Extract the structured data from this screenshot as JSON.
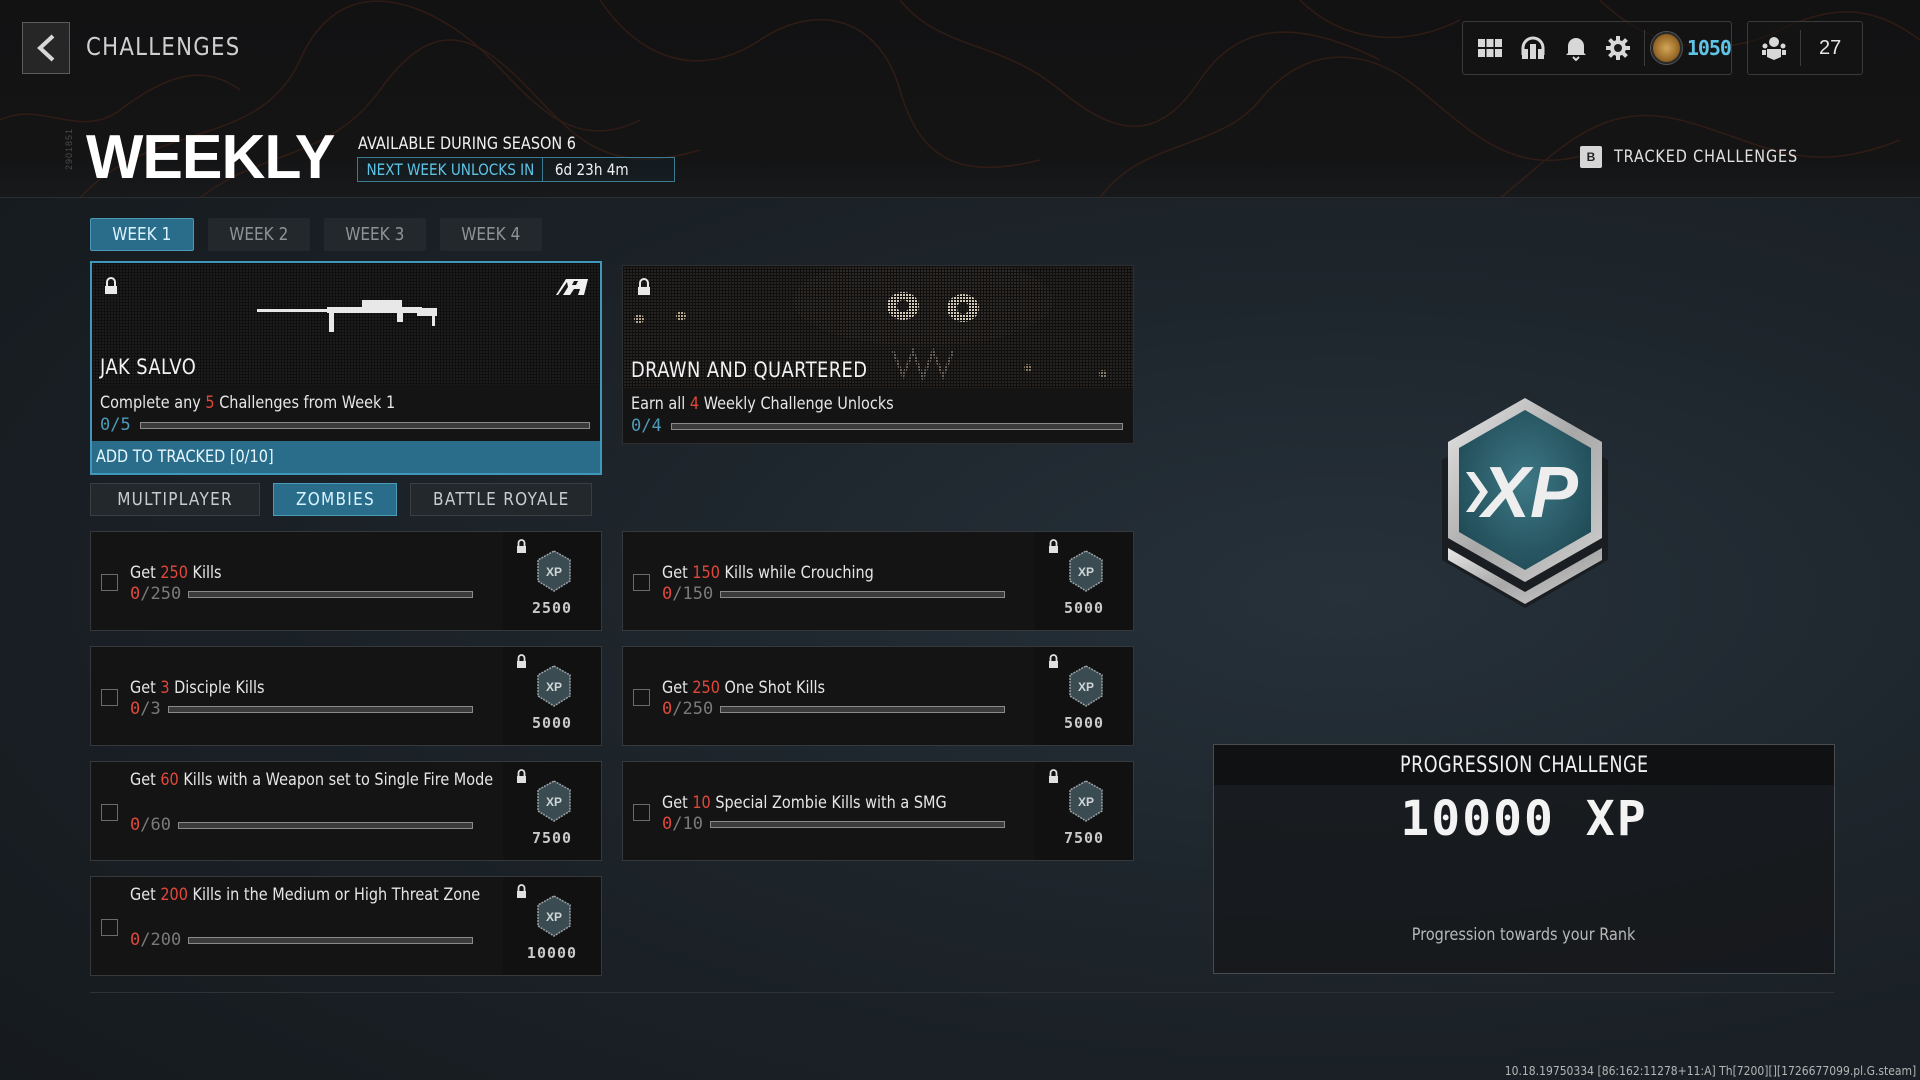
{
  "header": {
    "screen_title": "CHALLENGES",
    "season_code": "2901851",
    "page_title": "WEEKLY",
    "availability": "AVAILABLE DURING SEASON 6",
    "next_unlock_label": "NEXT WEEK UNLOCKS IN",
    "next_unlock_time": "6d 23h 4m",
    "tracked_key": "B",
    "tracked_label": "TRACKED CHALLENGES"
  },
  "top_bar": {
    "icons": [
      "grid-menu-icon",
      "headset-icon",
      "bell-icon",
      "gear-icon"
    ],
    "currency_value": "1050",
    "party_count": "27",
    "accent_color": "#5fc3e6"
  },
  "week_tabs": [
    {
      "label": "WEEK 1",
      "active": true
    },
    {
      "label": "WEEK 2",
      "active": false
    },
    {
      "label": "WEEK 3",
      "active": false
    },
    {
      "label": "WEEK 4",
      "active": false
    }
  ],
  "rewards": [
    {
      "name": "JAK SALVO",
      "desc_pre": "Complete any ",
      "desc_num": "5",
      "desc_post": " Challenges from Week 1",
      "progress": "0/5",
      "progress_value": 0,
      "progress_max": 5,
      "locked": true,
      "selected": true,
      "track_label": "ADD TO TRACKED [0/10]"
    },
    {
      "name": "DRAWN AND QUARTERED",
      "desc_pre": "Earn all ",
      "desc_num": "4",
      "desc_post": " Weekly Challenge Unlocks",
      "progress": "0/4",
      "progress_value": 0,
      "progress_max": 4,
      "locked": true,
      "selected": false
    }
  ],
  "mode_tabs": [
    {
      "label": "MULTIPLAYER",
      "active": false
    },
    {
      "label": "ZOMBIES",
      "active": true
    },
    {
      "label": "BATTLE ROYALE",
      "active": false
    }
  ],
  "challenges": [
    {
      "pre": "Get ",
      "num": "250",
      "post": " Kills",
      "current": "0",
      "total": "/250",
      "xp": "2500",
      "locked": true
    },
    {
      "pre": "Get ",
      "num": "150",
      "post": " Kills while Crouching",
      "current": "0",
      "total": "/150",
      "xp": "5000",
      "locked": true
    },
    {
      "pre": "Get ",
      "num": "3",
      "post": " Disciple Kills",
      "current": "0",
      "total": "/3",
      "xp": "5000",
      "locked": true
    },
    {
      "pre": "Get ",
      "num": "250",
      "post": " One Shot Kills",
      "current": "0",
      "total": "/250",
      "xp": "5000",
      "locked": true
    },
    {
      "pre": "Get ",
      "num": "60",
      "post": " Kills with a Weapon set to Single Fire Mode",
      "current": "0",
      "total": "/60",
      "xp": "7500",
      "locked": true
    },
    {
      "pre": "Get ",
      "num": "10",
      "post": " Special Zombie Kills with a SMG",
      "current": "0",
      "total": "/10",
      "xp": "7500",
      "locked": true
    },
    {
      "pre": "Get ",
      "num": "200",
      "post": " Kills in the Medium or High Threat Zone",
      "current": "0",
      "total": "/200",
      "xp": "10000",
      "locked": true
    }
  ],
  "progression": {
    "emblem_text": "XP",
    "title": "PROGRESSION CHALLENGE",
    "xp": "10000 XP",
    "subtitle": "Progression towards your Rank"
  },
  "footer": {
    "build_info": "10.18.19750334 [86:162:11278+11:A] Th[7200][][1726677099.pl.G.steam]"
  }
}
